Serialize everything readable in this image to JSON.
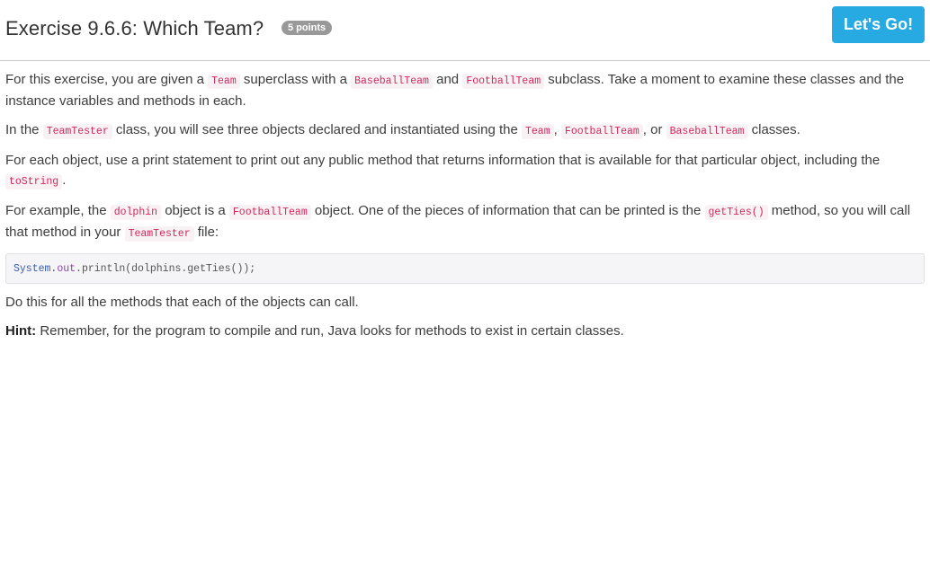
{
  "header": {
    "title": "Exercise 9.6.6: Which Team?",
    "points_badge": "5 points",
    "go_button_label": "Let's Go!"
  },
  "colors": {
    "accent": "#27a9e1",
    "badge": "#999999",
    "inline_code": "#d0285c",
    "inline_code_bg": "#f9f2f4"
  },
  "content": {
    "p1": {
      "t1": "For this exercise, you are given a ",
      "c1": "Team",
      "t2": " superclass with a ",
      "c2": "BaseballTeam",
      "t3": " and ",
      "c3": "FootballTeam",
      "t4": " subclass. Take a moment to examine these classes and the instance variables and methods in each."
    },
    "p2": {
      "t1": "In the ",
      "c1": "TeamTester",
      "t2": " class, you will see three objects declared and instantiated using the ",
      "c2": "Team",
      "t3": ", ",
      "c3": "FootballTeam",
      "t4": ", or ",
      "c4": "BaseballTeam",
      "t5": " classes."
    },
    "p3": {
      "t1": "For each object, use a print statement to print out any public method that returns information that is available for that particular object, including the ",
      "c1": "toString",
      "t2": "."
    },
    "p4": {
      "t1": "For example, the ",
      "c1": "dolphin",
      "t2": " object is a ",
      "c2": "FootballTeam",
      "t3": " object. One of the pieces of information that can be printed is the ",
      "c3": "getTies()",
      "t4": " method, so you will call that method in your ",
      "c4": "TeamTester",
      "t5": " file:"
    },
    "code": {
      "class": "System",
      "dot1": ".",
      "field": "out",
      "rest": ".println(dolphins.getTies());"
    },
    "p5": "Do this for all the methods that each of the objects can call.",
    "hint": {
      "label": "Hint:",
      "text": " Remember, for the program to compile and run, Java looks for methods to exist in certain classes."
    }
  }
}
